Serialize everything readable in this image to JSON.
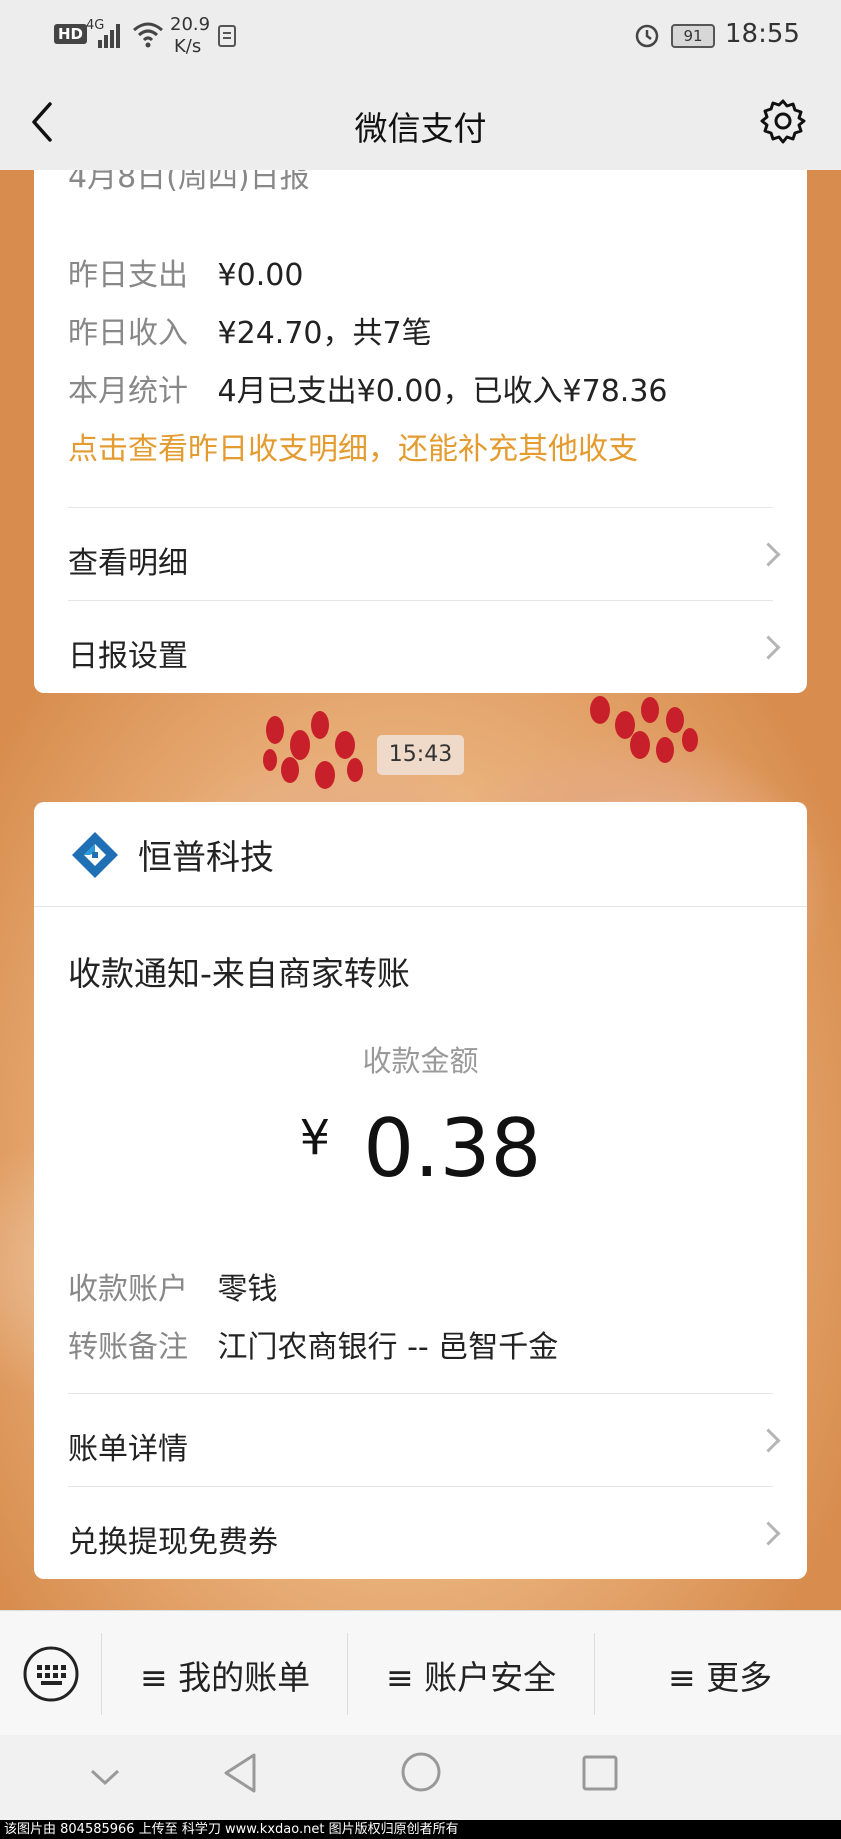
{
  "status_bar": {
    "hd": "HD",
    "network": "4G",
    "speed_value": "20.9",
    "speed_unit": "K/s",
    "battery": "91",
    "time": "18:55"
  },
  "nav": {
    "title": "微信支付"
  },
  "report_card": {
    "partial_heading": "4月8日(周四)日报",
    "rows": [
      {
        "label": "昨日支出",
        "value": "¥0.00"
      },
      {
        "label": "昨日收入",
        "value": "¥24.70，共7笔"
      },
      {
        "label": "本月统计",
        "value": "4月已支出¥0.00，已收入¥78.36"
      }
    ],
    "link_text": "点击查看昨日收支明细，还能补充其他收支",
    "menu": [
      {
        "label": "查看明细"
      },
      {
        "label": "日报设置"
      }
    ]
  },
  "timestamp": "15:43",
  "payment_card": {
    "merchant": "恒普科技",
    "title": "收款通知-来自商家转账",
    "amount_label": "收款金额",
    "currency": "¥",
    "amount": "0.38",
    "details": [
      {
        "label": "收款账户",
        "value": "零钱"
      },
      {
        "label": "转账备注",
        "value": "江门农商银行 -- 邑智千金"
      }
    ],
    "menu": [
      {
        "label": "账单详情"
      },
      {
        "label": "兑换提现免费券"
      }
    ]
  },
  "tabbar": {
    "items": [
      {
        "label": "≡ 我的账单"
      },
      {
        "label": "≡ 账户安全"
      },
      {
        "label": "≡ 更多"
      }
    ]
  },
  "footer": {
    "text": "该图片由 804585966 上传至 科学刀 www.kxdao.net 图片版权归原创者所有"
  },
  "colors": {
    "accent_orange": "#e49b2f",
    "logo_blue": "#1f6fb5"
  }
}
